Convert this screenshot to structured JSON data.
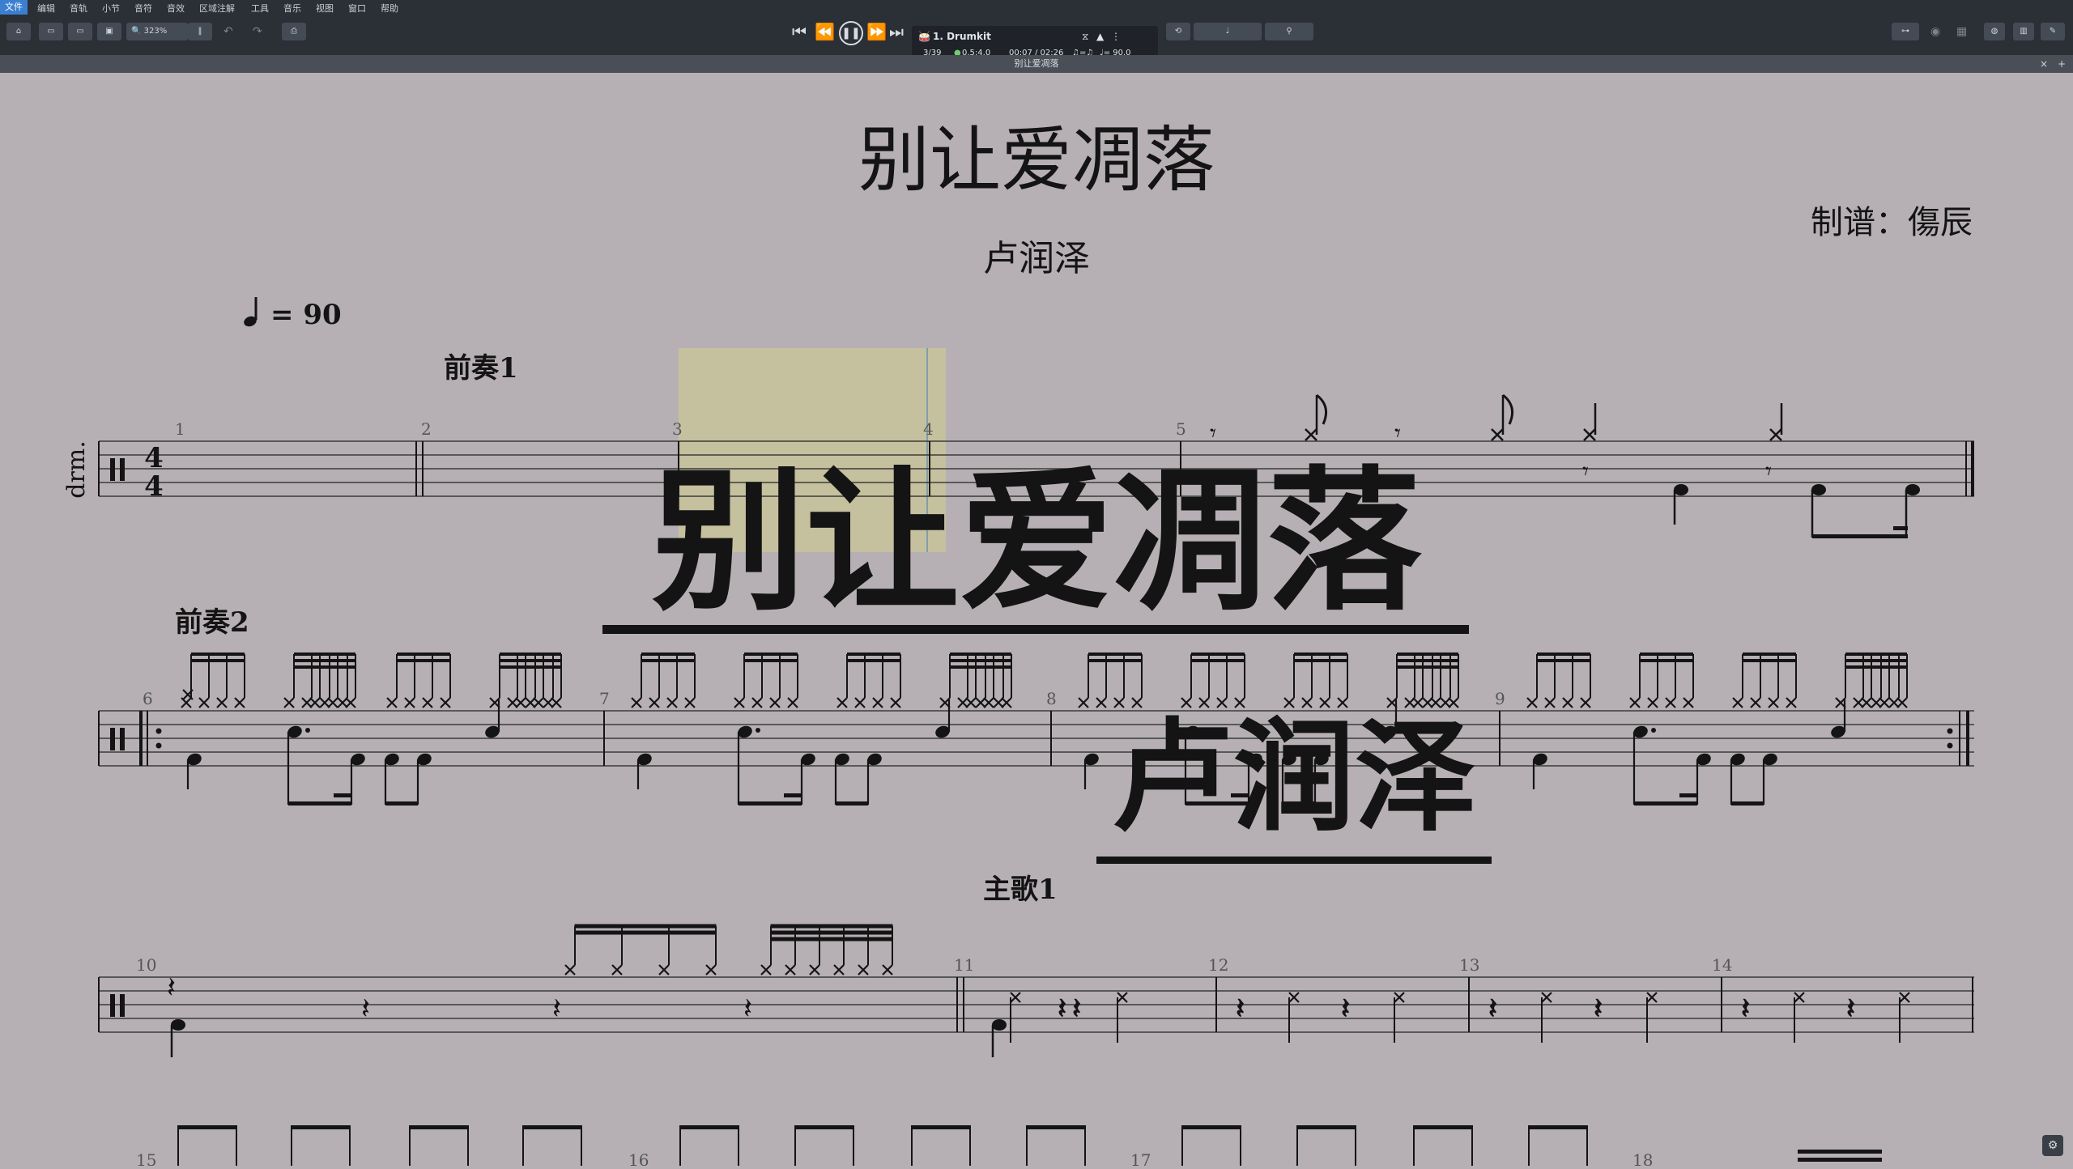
{
  "menu": [
    "文件",
    "编辑",
    "音轨",
    "小节",
    "音符",
    "音效",
    "区域注解",
    "工具",
    "音乐",
    "视图",
    "窗口",
    "帮助"
  ],
  "toolbar": {
    "zoom": "323%"
  },
  "track": {
    "name": "1. Drumkit",
    "position": "3/39",
    "beat": "0.5:4.0",
    "time": "00:07 / 02:26",
    "tempo": "♩= 90.0"
  },
  "tab": {
    "title": "别让爱凋落"
  },
  "score": {
    "title": "别让爱凋落",
    "artist": "卢润泽",
    "transcriber": "制谱：傷辰",
    "tempo_value": "= 90",
    "instrument": "drm.",
    "time_signature_top": "4",
    "time_signature_bottom": "4",
    "sections": [
      "前奏1",
      "前奏2",
      "主歌1"
    ],
    "measure_numbers": [
      "1",
      "2",
      "3",
      "4",
      "5",
      "6",
      "7",
      "8",
      "9",
      "10",
      "11",
      "12",
      "13",
      "14",
      "15",
      "16",
      "17",
      "18"
    ]
  },
  "overlay": {
    "title_text": "别让爱凋落",
    "artist_text": "卢润泽"
  },
  "colors": {
    "paper": "#b6b0b4",
    "toolbar": "#2b2f36",
    "cursor": "#c8c39a",
    "ink": "#141414",
    "accent": "#3b7fd0"
  }
}
